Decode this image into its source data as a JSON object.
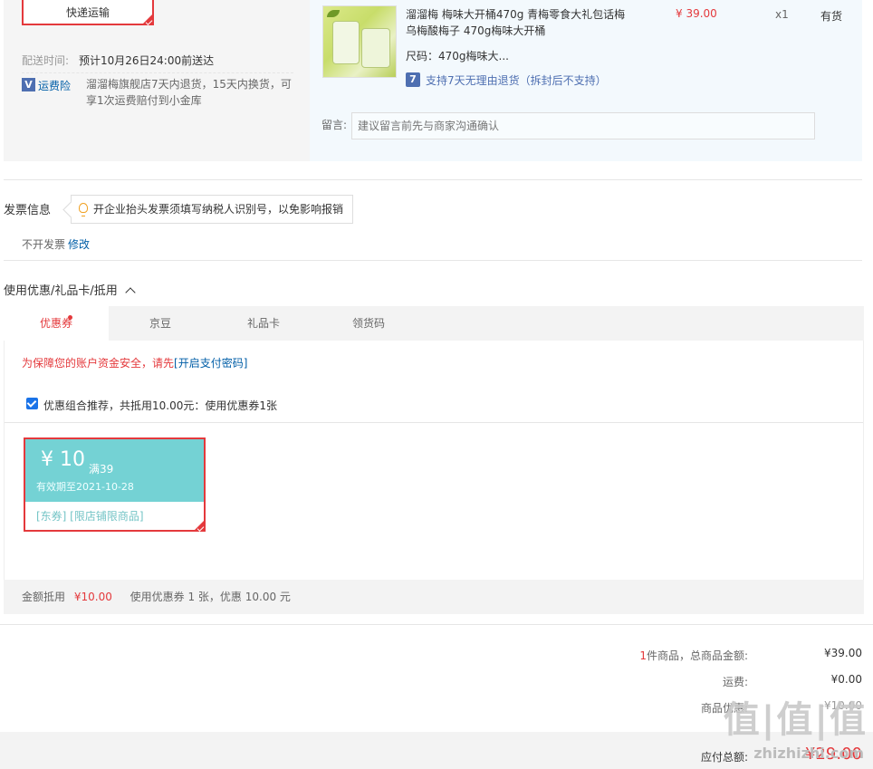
{
  "shipping": {
    "method": "快递运输",
    "delivery_label": "配送时间:",
    "delivery_value": "预计10月26日24:00前送达",
    "insurance_label": "运费险",
    "insurance_icon": "V",
    "insurance_desc_1": "溜溜梅旗舰店7天内退货，15天内换货，可",
    "insurance_desc_2": "享1次运费赔付到小金库"
  },
  "product": {
    "title_1": "溜溜梅 梅味大开桶470g 青梅零食大礼包话梅",
    "title_2": "乌梅酸梅子 470g梅味大开桶",
    "spec": "尺码：470g梅味大...",
    "price": "¥ 39.00",
    "qty": "x1",
    "stock": "有货",
    "return_icon": "7",
    "return_policy": "支持7天无理由退货（拆封后不支持）",
    "memo_label": "留言:",
    "memo_placeholder": "建议留言前先与商家沟通确认"
  },
  "invoice": {
    "title": "发票信息",
    "tip": "开企业抬头发票须填写纳税人识别号，以免影响报销",
    "status": "不开发票",
    "edit": "修改"
  },
  "discount": {
    "title": "使用优惠/礼品卡/抵用",
    "tabs": [
      "优惠券",
      "京豆",
      "礼品卡",
      "领货码"
    ],
    "warning": "为保障您的账户资金安全，请先",
    "warning_link": "[开启支付密码]",
    "combo_text": "优惠组合推荐，共抵用10.00元：使用优惠券1张",
    "coupon": {
      "value": "¥ 10",
      "condition": "满39",
      "expiry": "有效期至2021-10-28",
      "tags": "[东券]  [限店铺限商品]"
    },
    "summary_label": "金额抵用",
    "summary_amount": "¥10.00",
    "summary_desc": "使用优惠券 1 张，优惠 10.00 元"
  },
  "totals": {
    "count": "1",
    "count_suffix": "件商品，总商品金额:",
    "goods_amount": "¥39.00",
    "freight_label": "运费:",
    "freight_amount": "¥0.00",
    "discount_label": "商品优惠:",
    "discount_amount": "-¥10.00",
    "payable_label": "应付总额:",
    "payable_amount": "¥29.00"
  },
  "watermark": {
    "main": "值|值|值",
    "sub": "zhizhizhi.com"
  },
  "colors": {
    "accent": "#e4393c",
    "link": "#005ea7",
    "coupon": "#74d2d4"
  }
}
